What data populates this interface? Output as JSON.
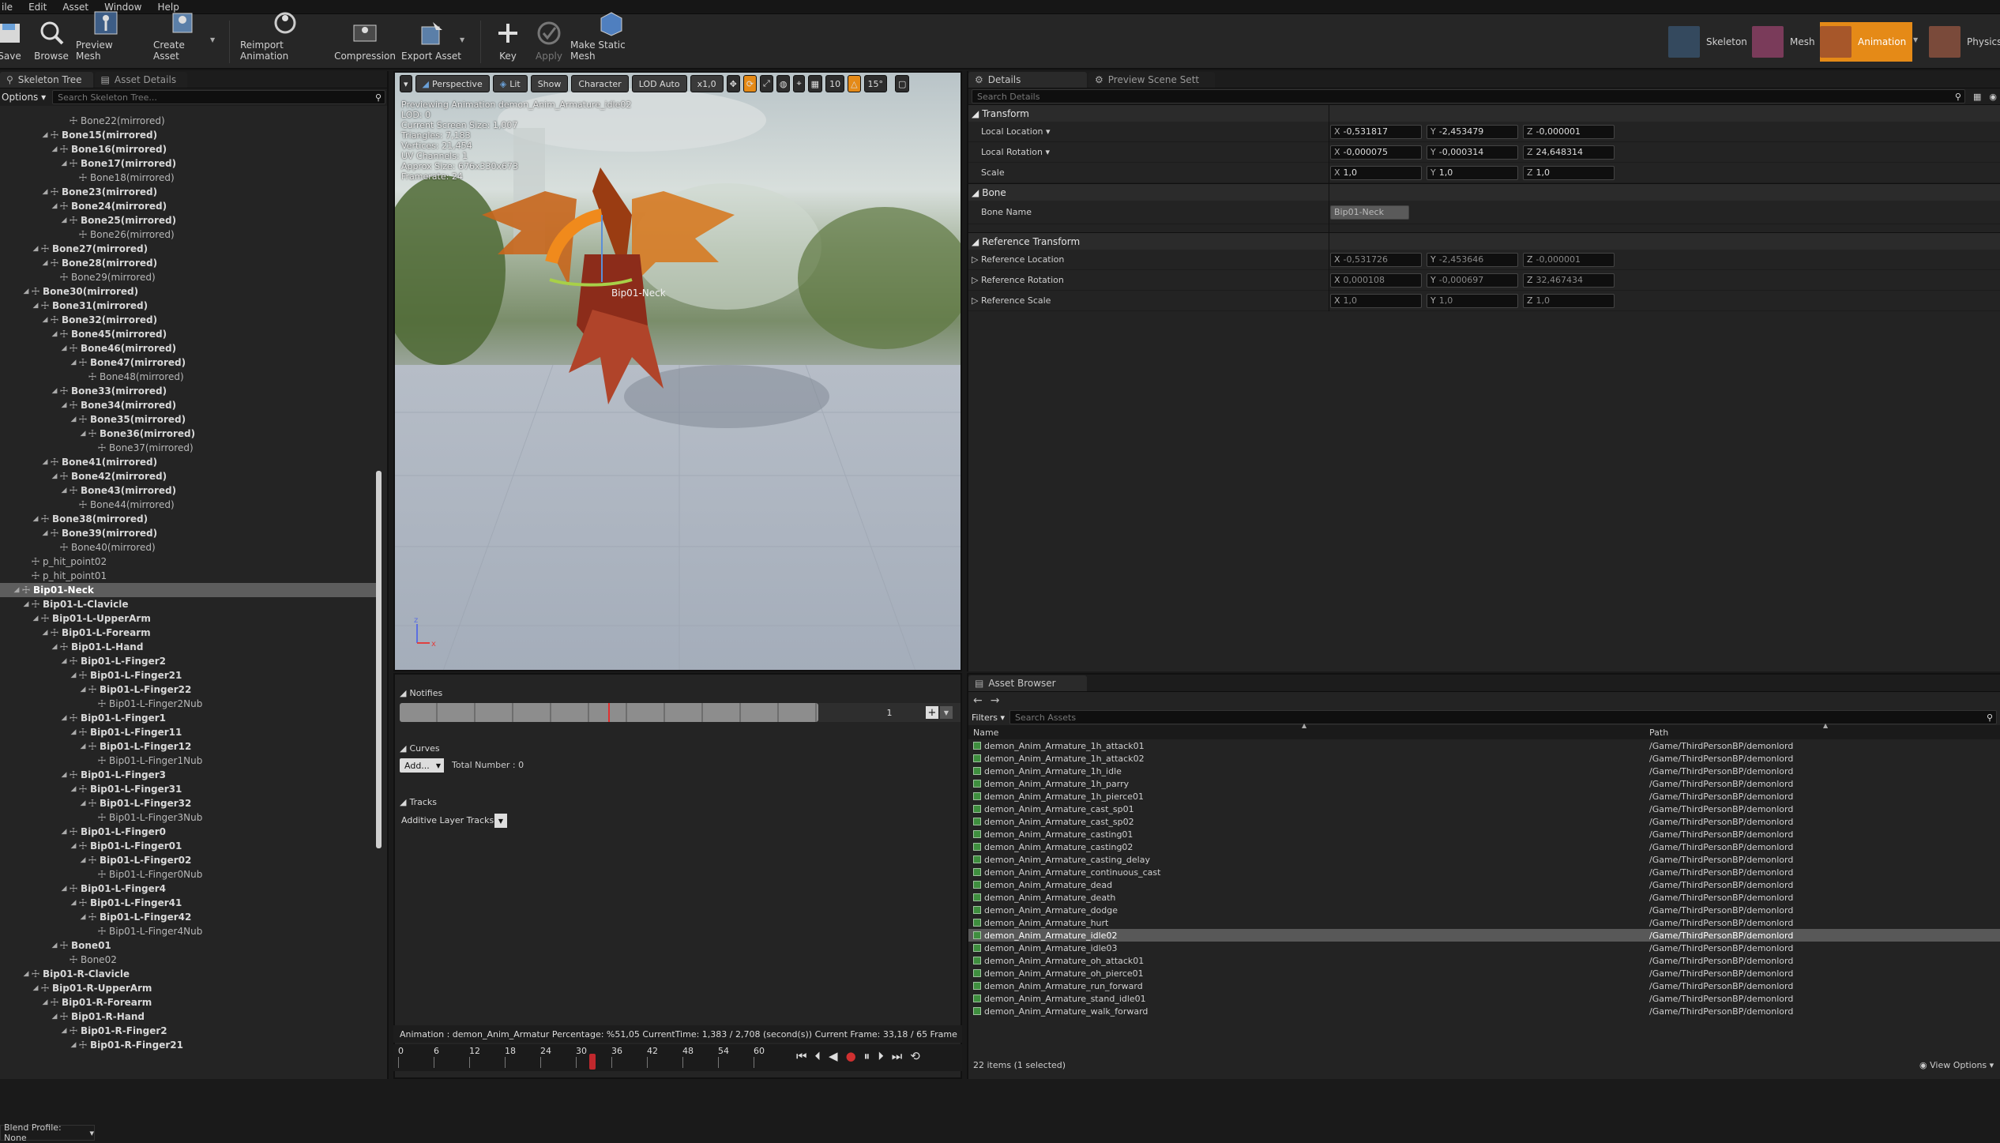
{
  "menu": [
    "ile",
    "Edit",
    "Asset",
    "Window",
    "Help"
  ],
  "toolbar": {
    "buttons": [
      {
        "label": "Save",
        "icon": "save-icon"
      },
      {
        "label": "Browse",
        "icon": "browse-icon"
      },
      {
        "label": "Preview Mesh",
        "icon": "preview-mesh-icon"
      },
      {
        "label": "Create Asset",
        "icon": "create-asset-icon"
      },
      {
        "label": "Reimport Animation",
        "icon": "reimport-icon"
      },
      {
        "label": "Compression",
        "icon": "compression-icon"
      },
      {
        "label": "Export Asset",
        "icon": "export-icon"
      },
      {
        "label": "Key",
        "icon": "plus-icon"
      },
      {
        "label": "Apply",
        "icon": "apply-icon"
      },
      {
        "label": "Make Static Mesh",
        "icon": "static-mesh-icon"
      }
    ],
    "modes": [
      {
        "label": "Skeleton",
        "icon": "skeleton-mode-icon",
        "active": false
      },
      {
        "label": "Mesh",
        "icon": "mesh-mode-icon",
        "active": false
      },
      {
        "label": "Animation",
        "icon": "animation-mode-icon",
        "active": true
      },
      {
        "label": "Physics",
        "icon": "physics-mode-icon",
        "active": false
      }
    ]
  },
  "left_panel": {
    "tabs": [
      "Skeleton Tree",
      "Asset Details"
    ],
    "options_label": "Options",
    "search_placeholder": "Search Skeleton Tree...",
    "blend_profile": "Blend Profile: None",
    "rows": [
      {
        "label": "Bone22(mirrored)",
        "indent": 6,
        "arrow": false,
        "bold": false
      },
      {
        "label": "Bone15(mirrored)",
        "indent": 4,
        "arrow": true,
        "bold": true
      },
      {
        "label": "Bone16(mirrored)",
        "indent": 5,
        "arrow": true,
        "bold": true
      },
      {
        "label": "Bone17(mirrored)",
        "indent": 6,
        "arrow": true,
        "bold": true
      },
      {
        "label": "Bone18(mirrored)",
        "indent": 7,
        "arrow": false,
        "bold": false
      },
      {
        "label": "Bone23(mirrored)",
        "indent": 4,
        "arrow": true,
        "bold": true
      },
      {
        "label": "Bone24(mirrored)",
        "indent": 5,
        "arrow": true,
        "bold": true
      },
      {
        "label": "Bone25(mirrored)",
        "indent": 6,
        "arrow": true,
        "bold": true
      },
      {
        "label": "Bone26(mirrored)",
        "indent": 7,
        "arrow": false,
        "bold": false
      },
      {
        "label": "Bone27(mirrored)",
        "indent": 3,
        "arrow": true,
        "bold": true
      },
      {
        "label": "Bone28(mirrored)",
        "indent": 4,
        "arrow": true,
        "bold": true
      },
      {
        "label": "Bone29(mirrored)",
        "indent": 5,
        "arrow": false,
        "bold": false
      },
      {
        "label": "Bone30(mirrored)",
        "indent": 2,
        "arrow": true,
        "bold": true
      },
      {
        "label": "Bone31(mirrored)",
        "indent": 3,
        "arrow": true,
        "bold": true
      },
      {
        "label": "Bone32(mirrored)",
        "indent": 4,
        "arrow": true,
        "bold": true
      },
      {
        "label": "Bone45(mirrored)",
        "indent": 5,
        "arrow": true,
        "bold": true
      },
      {
        "label": "Bone46(mirrored)",
        "indent": 6,
        "arrow": true,
        "bold": true
      },
      {
        "label": "Bone47(mirrored)",
        "indent": 7,
        "arrow": true,
        "bold": true
      },
      {
        "label": "Bone48(mirrored)",
        "indent": 8,
        "arrow": false,
        "bold": false
      },
      {
        "label": "Bone33(mirrored)",
        "indent": 5,
        "arrow": true,
        "bold": true
      },
      {
        "label": "Bone34(mirrored)",
        "indent": 6,
        "arrow": true,
        "bold": true
      },
      {
        "label": "Bone35(mirrored)",
        "indent": 7,
        "arrow": true,
        "bold": true
      },
      {
        "label": "Bone36(mirrored)",
        "indent": 8,
        "arrow": true,
        "bold": true
      },
      {
        "label": "Bone37(mirrored)",
        "indent": 9,
        "arrow": false,
        "bold": false
      },
      {
        "label": "Bone41(mirrored)",
        "indent": 4,
        "arrow": true,
        "bold": true
      },
      {
        "label": "Bone42(mirrored)",
        "indent": 5,
        "arrow": true,
        "bold": true
      },
      {
        "label": "Bone43(mirrored)",
        "indent": 6,
        "arrow": true,
        "bold": true
      },
      {
        "label": "Bone44(mirrored)",
        "indent": 7,
        "arrow": false,
        "bold": false
      },
      {
        "label": "Bone38(mirrored)",
        "indent": 3,
        "arrow": true,
        "bold": true
      },
      {
        "label": "Bone39(mirrored)",
        "indent": 4,
        "arrow": true,
        "bold": true
      },
      {
        "label": "Bone40(mirrored)",
        "indent": 5,
        "arrow": false,
        "bold": false
      },
      {
        "label": "p_hit_point02",
        "indent": 2,
        "arrow": false,
        "bold": false
      },
      {
        "label": "p_hit_point01",
        "indent": 2,
        "arrow": false,
        "bold": false
      },
      {
        "label": "Bip01-Neck",
        "indent": 1,
        "arrow": true,
        "bold": true,
        "selected": true
      },
      {
        "label": "Bip01-L-Clavicle",
        "indent": 2,
        "arrow": true,
        "bold": true
      },
      {
        "label": "Bip01-L-UpperArm",
        "indent": 3,
        "arrow": true,
        "bold": true
      },
      {
        "label": "Bip01-L-Forearm",
        "indent": 4,
        "arrow": true,
        "bold": true
      },
      {
        "label": "Bip01-L-Hand",
        "indent": 5,
        "arrow": true,
        "bold": true
      },
      {
        "label": "Bip01-L-Finger2",
        "indent": 6,
        "arrow": true,
        "bold": true
      },
      {
        "label": "Bip01-L-Finger21",
        "indent": 7,
        "arrow": true,
        "bold": true
      },
      {
        "label": "Bip01-L-Finger22",
        "indent": 8,
        "arrow": true,
        "bold": true
      },
      {
        "label": "Bip01-L-Finger2Nub",
        "indent": 9,
        "arrow": false,
        "bold": false
      },
      {
        "label": "Bip01-L-Finger1",
        "indent": 6,
        "arrow": true,
        "bold": true
      },
      {
        "label": "Bip01-L-Finger11",
        "indent": 7,
        "arrow": true,
        "bold": true
      },
      {
        "label": "Bip01-L-Finger12",
        "indent": 8,
        "arrow": true,
        "bold": true
      },
      {
        "label": "Bip01-L-Finger1Nub",
        "indent": 9,
        "arrow": false,
        "bold": false
      },
      {
        "label": "Bip01-L-Finger3",
        "indent": 6,
        "arrow": true,
        "bold": true
      },
      {
        "label": "Bip01-L-Finger31",
        "indent": 7,
        "arrow": true,
        "bold": true
      },
      {
        "label": "Bip01-L-Finger32",
        "indent": 8,
        "arrow": true,
        "bold": true
      },
      {
        "label": "Bip01-L-Finger3Nub",
        "indent": 9,
        "arrow": false,
        "bold": false
      },
      {
        "label": "Bip01-L-Finger0",
        "indent": 6,
        "arrow": true,
        "bold": true
      },
      {
        "label": "Bip01-L-Finger01",
        "indent": 7,
        "arrow": true,
        "bold": true
      },
      {
        "label": "Bip01-L-Finger02",
        "indent": 8,
        "arrow": true,
        "bold": true
      },
      {
        "label": "Bip01-L-Finger0Nub",
        "indent": 9,
        "arrow": false,
        "bold": false
      },
      {
        "label": "Bip01-L-Finger4",
        "indent": 6,
        "arrow": true,
        "bold": true
      },
      {
        "label": "Bip01-L-Finger41",
        "indent": 7,
        "arrow": true,
        "bold": true
      },
      {
        "label": "Bip01-L-Finger42",
        "indent": 8,
        "arrow": true,
        "bold": true
      },
      {
        "label": "Bip01-L-Finger4Nub",
        "indent": 9,
        "arrow": false,
        "bold": false
      },
      {
        "label": "Bone01",
        "indent": 5,
        "arrow": true,
        "bold": true
      },
      {
        "label": "Bone02",
        "indent": 6,
        "arrow": false,
        "bold": false
      },
      {
        "label": "Bip01-R-Clavicle",
        "indent": 2,
        "arrow": true,
        "bold": true
      },
      {
        "label": "Bip01-R-UpperArm",
        "indent": 3,
        "arrow": true,
        "bold": true
      },
      {
        "label": "Bip01-R-Forearm",
        "indent": 4,
        "arrow": true,
        "bold": true
      },
      {
        "label": "Bip01-R-Hand",
        "indent": 5,
        "arrow": true,
        "bold": true
      },
      {
        "label": "Bip01-R-Finger2",
        "indent": 6,
        "arrow": true,
        "bold": true
      },
      {
        "label": "Bip01-R-Finger21",
        "indent": 7,
        "arrow": true,
        "bold": true
      }
    ]
  },
  "viewport": {
    "toolbar": {
      "perspective": "Perspective",
      "lit": "Lit",
      "show": "Show",
      "character": "Character",
      "lod": "LOD Auto",
      "speed": "x1,0",
      "grid": "10",
      "angle": "15°"
    },
    "info": [
      "Previewing Animation demon_Anim_Armature_idle02",
      "LOD: 0",
      "Current Screen Size: 1,007",
      "Triangles: 7,183",
      "Vertices: 21,454",
      "UV Channels: 1",
      "Approx Size: 676x330x673",
      "Framerate: 24"
    ],
    "bone_label": "Bip01-Neck"
  },
  "anim_panel": {
    "notifies": "Notifies",
    "notify_track_value": "1",
    "curves": "Curves",
    "add_label": "Add...",
    "total_number": "Total Number : 0",
    "tracks": "Tracks",
    "additive": "Additive Layer Tracks",
    "status": "Animation :  demon_Anim_Armatur Percentage: %51,05 CurrentTime: 1,383 / 2,708 (second(s)) Current Frame: 33,18 / 65 Frame",
    "ticks": [
      "0",
      "6",
      "12",
      "18",
      "24",
      "30",
      "36",
      "42",
      "48",
      "54",
      "60"
    ]
  },
  "details": {
    "tabs": [
      "Details",
      "Preview Scene Sett"
    ],
    "search_placeholder": "Search Details",
    "transform": "Transform",
    "local_location": {
      "label": "Local Location",
      "x": "-0,531817",
      "y": "-2,453479",
      "z": "-0,000001"
    },
    "local_rotation": {
      "label": "Local Rotation",
      "x": "-0,000075",
      "y": "-0,000314",
      "z": "24,648314"
    },
    "scale": {
      "label": "Scale",
      "x": "1,0",
      "y": "1,0",
      "z": "1,0"
    },
    "bone": "Bone",
    "bone_name_label": "Bone Name",
    "bone_name": "Bip01-Neck",
    "reference_transform": "Reference Transform",
    "reference_location": {
      "label": "Reference Location",
      "x": "-0,531726",
      "y": "-2,453646",
      "z": "-0,000001"
    },
    "reference_rotation": {
      "label": "Reference Rotation",
      "x": "0,000108",
      "y": "-0,000697",
      "z": "32,467434"
    },
    "reference_scale": {
      "label": "Reference Scale",
      "x": "1,0",
      "y": "1,0",
      "z": "1,0"
    }
  },
  "asset_browser": {
    "tab": "Asset Browser",
    "filters": "Filters",
    "search_placeholder": "Search Assets",
    "col_name": "Name",
    "col_path": "Path",
    "status": "22 items (1 selected)",
    "view_options": "View Options",
    "items": [
      {
        "name": "demon_Anim_Armature_1h_attack01",
        "path": "/Game/ThirdPersonBP/demonlord"
      },
      {
        "name": "demon_Anim_Armature_1h_attack02",
        "path": "/Game/ThirdPersonBP/demonlord"
      },
      {
        "name": "demon_Anim_Armature_1h_idle",
        "path": "/Game/ThirdPersonBP/demonlord"
      },
      {
        "name": "demon_Anim_Armature_1h_parry",
        "path": "/Game/ThirdPersonBP/demonlord"
      },
      {
        "name": "demon_Anim_Armature_1h_pierce01",
        "path": "/Game/ThirdPersonBP/demonlord"
      },
      {
        "name": "demon_Anim_Armature_cast_sp01",
        "path": "/Game/ThirdPersonBP/demonlord"
      },
      {
        "name": "demon_Anim_Armature_cast_sp02",
        "path": "/Game/ThirdPersonBP/demonlord"
      },
      {
        "name": "demon_Anim_Armature_casting01",
        "path": "/Game/ThirdPersonBP/demonlord"
      },
      {
        "name": "demon_Anim_Armature_casting02",
        "path": "/Game/ThirdPersonBP/demonlord"
      },
      {
        "name": "demon_Anim_Armature_casting_delay",
        "path": "/Game/ThirdPersonBP/demonlord"
      },
      {
        "name": "demon_Anim_Armature_continuous_cast",
        "path": "/Game/ThirdPersonBP/demonlord"
      },
      {
        "name": "demon_Anim_Armature_dead",
        "path": "/Game/ThirdPersonBP/demonlord"
      },
      {
        "name": "demon_Anim_Armature_death",
        "path": "/Game/ThirdPersonBP/demonlord"
      },
      {
        "name": "demon_Anim_Armature_dodge",
        "path": "/Game/ThirdPersonBP/demonlord"
      },
      {
        "name": "demon_Anim_Armature_hurt",
        "path": "/Game/ThirdPersonBP/demonlord"
      },
      {
        "name": "demon_Anim_Armature_idle02",
        "path": "/Game/ThirdPersonBP/demonlord",
        "selected": true
      },
      {
        "name": "demon_Anim_Armature_idle03",
        "path": "/Game/ThirdPersonBP/demonlord"
      },
      {
        "name": "demon_Anim_Armature_oh_attack01",
        "path": "/Game/ThirdPersonBP/demonlord"
      },
      {
        "name": "demon_Anim_Armature_oh_pierce01",
        "path": "/Game/ThirdPersonBP/demonlord"
      },
      {
        "name": "demon_Anim_Armature_run_forward",
        "path": "/Game/ThirdPersonBP/demonlord"
      },
      {
        "name": "demon_Anim_Armature_stand_idle01",
        "path": "/Game/ThirdPersonBP/demonlord"
      },
      {
        "name": "demon_Anim_Armature_walk_forward",
        "path": "/Game/ThirdPersonBP/demonlord"
      }
    ]
  },
  "colors": {
    "accent": "#e58a17",
    "selection": "#5d5d5d",
    "panel": "#242424"
  }
}
